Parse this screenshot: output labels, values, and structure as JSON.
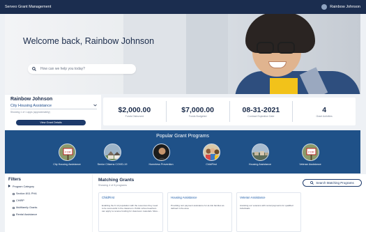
{
  "app": {
    "title": "Serveo Grant Management"
  },
  "user": {
    "name": "Rainbow Johnson"
  },
  "hero": {
    "welcome": "Welcome back, Rainbow Johnson",
    "search_placeholder": "How can we help you today?"
  },
  "profile": {
    "name": "Rainbow Johnson",
    "selected_program": "City Housing Assistance",
    "showing": "Showing 1 of 1 apps (approximately)",
    "button": "View Grant Details"
  },
  "stats": [
    {
      "value": "$2,000.00",
      "label": "Funds Disbursed"
    },
    {
      "value": "$7,000.00",
      "label": "Funds Budgeted"
    },
    {
      "value": "08-31-2021",
      "label": "Contract Expiration Date"
    },
    {
      "value": "4",
      "label": "Grant Activities"
    }
  ],
  "popular": {
    "title": "Popular Grant Programs",
    "programs": [
      {
        "label": "City Housing Assistance",
        "icon": "for-rent-sign-icon"
      },
      {
        "label": "Senior Citizens COVID-19",
        "icon": "houses-icon"
      },
      {
        "label": "Homeless Prevention",
        "icon": "person-icon"
      },
      {
        "label": "ChildFirst",
        "icon": "children-icon"
      },
      {
        "label": "Housing Assistance",
        "icon": "neighborhood-icon"
      },
      {
        "label": "Veteran Assistance",
        "icon": "for-rent-sign-icon"
      }
    ]
  },
  "filters": {
    "title": "Filters",
    "category": "Program Category",
    "options": [
      "Section 8/11 PHA",
      "CHIRP",
      "Multifamily Grants",
      "Rental Assistance"
    ]
  },
  "grants": {
    "title": "Matching Grants",
    "showing": "Showing 4 of 8 programs",
    "search_button": "Search Matching Programs",
    "cards": [
      {
        "title": "ChildFirst",
        "desc": "Enabling the K-12 population with the resources they need to be successful in the classroom. Public school teachers can apply to receive funding for classroom materials. More..."
      },
      {
        "title": "Housing Assistance",
        "desc": "Providing rent payment assistance for at-risk families as defined in the area"
      },
      {
        "title": "Veteran Assistance",
        "desc": "Assisting our veterans with rental payments for qualified individuals"
      }
    ]
  },
  "colors": {
    "topbar": "#1b2d4f",
    "band": "#1f5188",
    "primary_button": "#1d3a6b",
    "link": "#1a5aa8"
  }
}
